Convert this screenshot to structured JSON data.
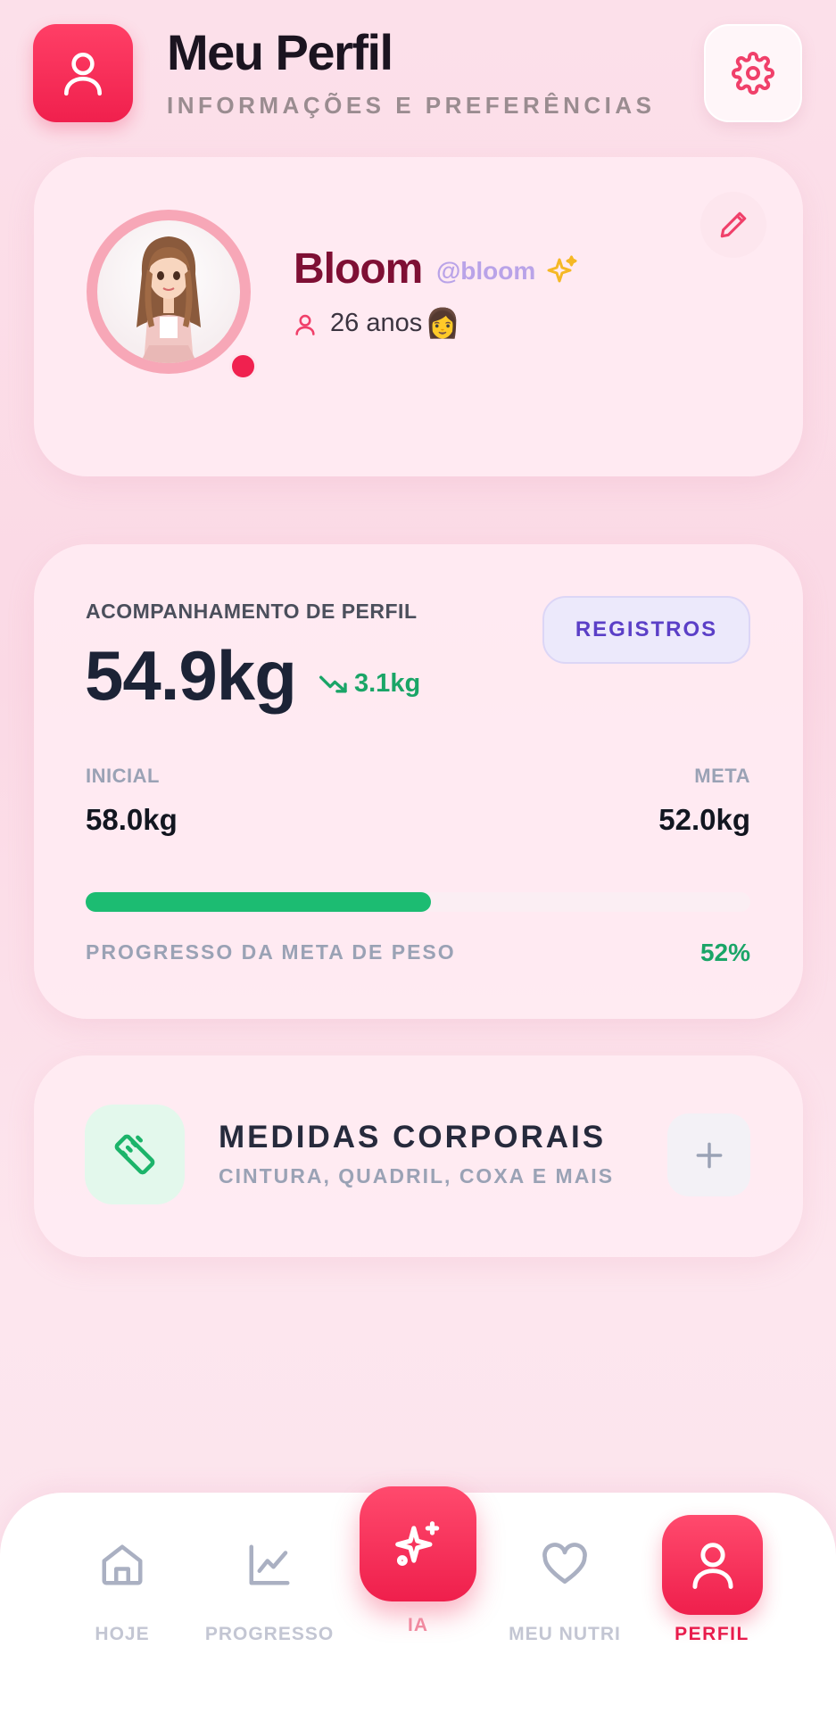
{
  "header": {
    "title": "Meu Perfil",
    "subtitle": "INFORMAÇÕES E PREFERÊNCIAS",
    "icon": "user-icon",
    "settings_icon": "gear-icon"
  },
  "profile": {
    "name": "Bloom",
    "handle": "@bloom",
    "age": "26 anos",
    "age_emoji": "👩",
    "edit_icon": "pencil-icon",
    "status_color": "#f0214f"
  },
  "tracking": {
    "label": "ACOMPANHAMENTO DE PERFIL",
    "current_weight": "54.9kg",
    "delta": "3.1kg",
    "records_button": "REGISTROS",
    "initial_label": "INICIAL",
    "initial_value": "58.0kg",
    "goal_label": "META",
    "goal_value": "52.0kg",
    "progress_label": "PROGRESSO DA META DE PESO",
    "progress_text": "52%",
    "progress_fraction": 0.52
  },
  "measures": {
    "title": "MEDIDAS CORPORAIS",
    "subtitle": "CINTURA, QUADRIL, COXA E MAIS",
    "icon": "ruler-icon",
    "add_icon": "plus-icon"
  },
  "nav": {
    "items": [
      {
        "label": "HOJE",
        "icon": "home-icon"
      },
      {
        "label": "PROGRESSO",
        "icon": "chart-icon"
      },
      {
        "label": "IA",
        "icon": "sparkles-icon"
      },
      {
        "label": "MEU NUTRI",
        "icon": "heart-icon"
      },
      {
        "label": "PERFIL",
        "icon": "user-icon"
      }
    ],
    "active": "PERFIL"
  },
  "colors": {
    "accent": "#f0204d",
    "green": "#1cbc72",
    "purple": "#5b3fc7"
  }
}
